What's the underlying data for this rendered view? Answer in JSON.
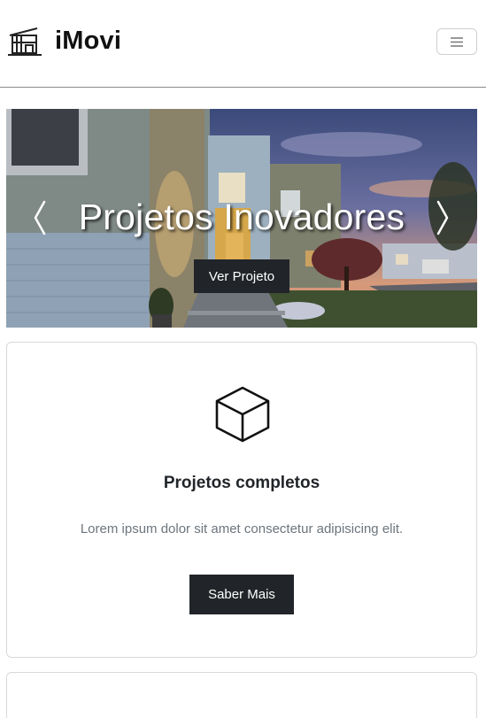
{
  "brand": {
    "name": "iMovi",
    "logo_icon": "house-building-icon"
  },
  "navbar": {
    "toggler_icon": "hamburger-menu-icon"
  },
  "carousel": {
    "title": "Projetos Inovadores",
    "button_label": "Ver Projeto",
    "prev_icon": "chevron-left-icon",
    "next_icon": "chevron-right-icon"
  },
  "cards": [
    {
      "icon": "cube-icon",
      "title": "Projetos completos",
      "text": "Lorem ipsum dolor sit amet consectetur adipisicing elit.",
      "button_label": "Saber Mais"
    }
  ],
  "colors": {
    "dark_button": "#212529",
    "muted_text": "#6c757d",
    "border": "#d9d9d9"
  }
}
